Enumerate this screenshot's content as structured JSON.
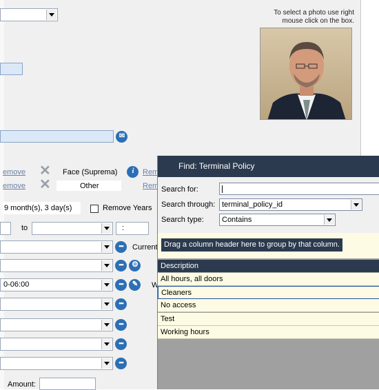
{
  "photo_hint": "To select a photo use right mouse click on the box.",
  "biometric": {
    "remove_link_1": "emove",
    "remove_link_2": "emove",
    "device_1": "Face (Suprema)",
    "device_2": "Other",
    "rem_link_1": "Rem",
    "rem_link_2": "Rem"
  },
  "validity": {
    "duration": "9 month(s), 3 day(s)",
    "remove_years_label": "Remove Years"
  },
  "date_range": {
    "to_label": "to",
    "time_value": ":"
  },
  "rows": {
    "current_label": "Current",
    "timezone_value": "0-06:00",
    "timezone_side_label": "W"
  },
  "amount_label": "Amount:",
  "dialog": {
    "title": "Find: Terminal Policy",
    "search_for_label": "Search for:",
    "search_for_value": "",
    "search_through_label": "Search through:",
    "search_through_value": "terminal_policy_id",
    "search_type_label": "Search type:",
    "search_type_value": "Contains",
    "group_hint": "Drag a column header here to group by that column.",
    "column_header": "Description",
    "results": [
      "All hours, all doors",
      "Cleaners",
      "No access",
      "Test",
      "Working hours"
    ],
    "selected_index": 1
  },
  "colors": {
    "accent": "#2c6fb5",
    "title_bar": "#2b3a4e",
    "grid_row": "#fdfbe3"
  }
}
